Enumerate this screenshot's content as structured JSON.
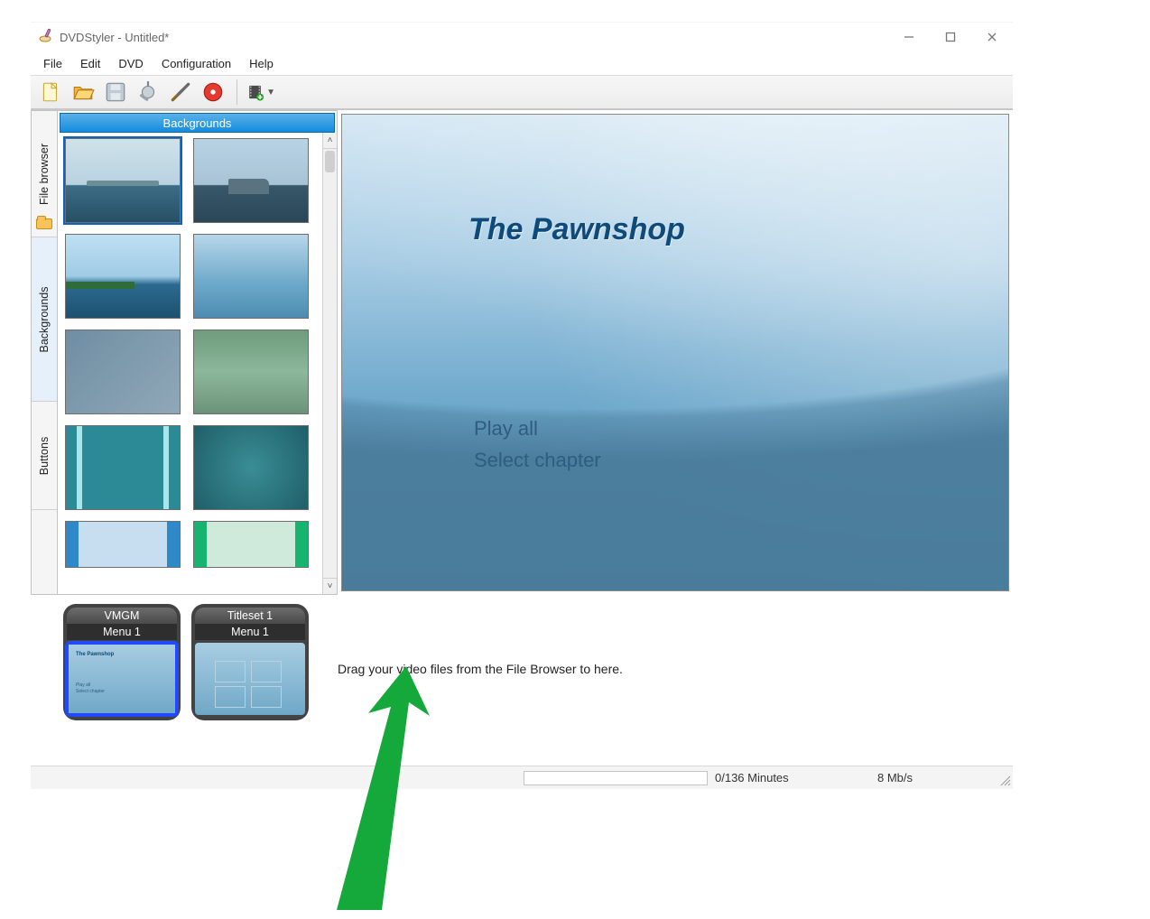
{
  "window": {
    "title": "DVDStyler - Untitled*"
  },
  "menubar": {
    "items": [
      "File",
      "Edit",
      "DVD",
      "Configuration",
      "Help"
    ]
  },
  "toolbar": {
    "buttons": [
      "new",
      "open",
      "save",
      "options",
      "tools",
      "burn"
    ],
    "dropdown": "add-title"
  },
  "sidetabs": {
    "items": [
      {
        "id": "file-browser",
        "label": "File browser"
      },
      {
        "id": "backgrounds",
        "label": "Backgrounds"
      },
      {
        "id": "buttons",
        "label": "Buttons"
      }
    ],
    "active": "backgrounds"
  },
  "backgrounds_panel": {
    "header": "Backgrounds",
    "selected_index": 0,
    "thumbs": [
      "seascape-1",
      "seascape-2",
      "lake",
      "gradient-blue",
      "slate-blur",
      "green-blur",
      "teal-bars",
      "deep-teal",
      "lightblue-bars",
      "lightgreen-bars"
    ]
  },
  "preview": {
    "title": "The Pawnshop",
    "menu_items": [
      "Play all",
      "Select chapter"
    ]
  },
  "timeline": {
    "tiles": [
      {
        "group": "VMGM",
        "label": "Menu 1",
        "kind": "title-menu",
        "selected": true
      },
      {
        "group": "Titleset 1",
        "label": "Menu 1",
        "kind": "chapter-menu",
        "selected": false
      }
    ],
    "drop_hint": "Drag your video files from the File Browser to here."
  },
  "statusbar": {
    "minutes": "0/136 Minutes",
    "bitrate": "8 Mb/s"
  }
}
